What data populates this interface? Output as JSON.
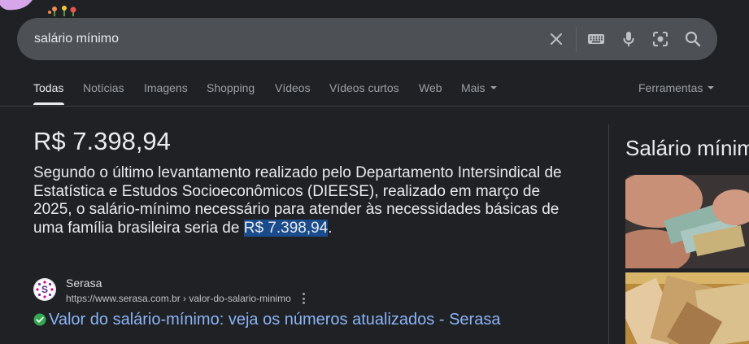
{
  "search": {
    "query": "salário mínimo"
  },
  "tabs": [
    {
      "label": "Todas"
    },
    {
      "label": "Notícias"
    },
    {
      "label": "Imagens"
    },
    {
      "label": "Shopping"
    },
    {
      "label": "Vídeos"
    },
    {
      "label": "Vídeos curtos"
    },
    {
      "label": "Web"
    },
    {
      "label": "Mais"
    }
  ],
  "tools_label": "Ferramentas",
  "featured": {
    "answer": "R$ 7.398,94",
    "snippet_text": "Segundo o último levantamento realizado pelo Departamento Intersindical de Estatística e Estudos Socioeconômicos (DIEESE), realizado em março de 2025, o salário-mínimo necessário para atender às necessidades básicas de uma família brasileira seria de ",
    "snippet_highlight": "R$ 7.398,94",
    "snippet_end": "."
  },
  "source": {
    "name": "Serasa",
    "url": "https://www.serasa.com.br › valor-do-salario-minimo",
    "favicon_letter": "S"
  },
  "result": {
    "title": "Valor do salário-mínimo: veja os números atualizados - Serasa"
  },
  "knowledge_panel": {
    "title": "Salário mínimo"
  },
  "colors": {
    "background": "#202124",
    "search_bar": "#4d5156",
    "link": "#8ab4f8",
    "highlight": "#1a4b8c",
    "check": "#34a853"
  }
}
